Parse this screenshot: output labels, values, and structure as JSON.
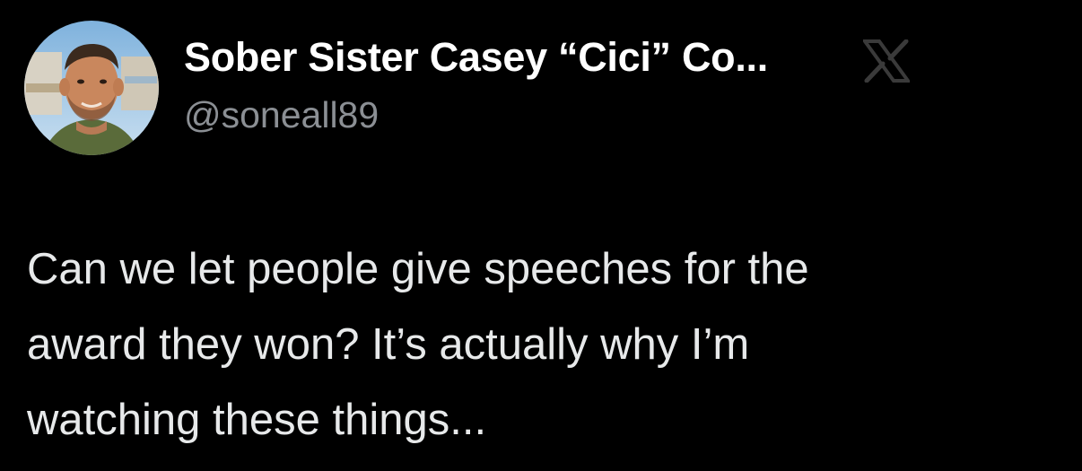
{
  "author": {
    "display_name": "Sober Sister Casey “Cici” Co...",
    "handle": "@soneall89",
    "avatar_icon": "profile-photo-avatar"
  },
  "platform": {
    "logo_icon": "x-logo-icon"
  },
  "tweet": {
    "lines": [
      "Can we let people give speeches for the",
      "award they won? It’s actually why I’m",
      "watching these things..."
    ]
  },
  "colors": {
    "background": "#000000",
    "name": "#ffffff",
    "handle": "#8b8f94",
    "body_text": "#e7e9ea",
    "logo": "#3a3a3a"
  }
}
